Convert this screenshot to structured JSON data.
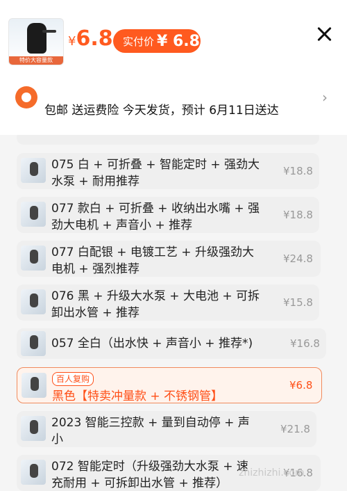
{
  "header": {
    "thumb_caption": "特价大容量款",
    "price_currency": "¥",
    "price_value": "6.8",
    "pay_label": "实付价",
    "pay_value": "¥ 6.8",
    "shipping_text": "包邮  送运费险  今天发货，预计 6月11日送达"
  },
  "options": [
    {
      "name": "075 白 + 可折叠 + 智能定时 + 强劲大水泵 + 耐用推荐",
      "price": "¥18.8"
    },
    {
      "name": "077 款白 + 可折叠 + 收纳出水嘴 + 强劲大电机 + 声音小 + 推荐",
      "price": "¥18.8"
    },
    {
      "name": "077 白配银 + 电镀工艺 + 升级强劲大电机 + 强烈推荐",
      "price": "¥24.8"
    },
    {
      "name": "076 黑 + 升级大水泵 + 大电池 + 可拆卸出水管 + 推荐",
      "price": "¥15.8"
    },
    {
      "name": "057 全白（出水快 + 声音小 + 推荐*)",
      "price": "¥16.8"
    },
    {
      "badge": "百人复购",
      "name": "黑色【特卖冲量款 + 不锈钢管】",
      "price": "¥6.8",
      "selected": true
    },
    {
      "name": "2023 智能三控款 + 量到自动停 + 声小",
      "price": "¥21.8"
    },
    {
      "name": "072 智能定时（升级强劲大水泵 + 速充耐用 + 可拆卸出水管 + 推荐）",
      "price": "¥16.8"
    }
  ],
  "watermark": "zhizhizhi.com"
}
